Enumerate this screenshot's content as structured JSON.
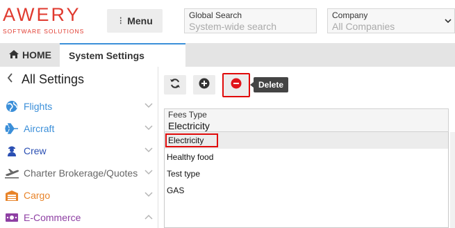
{
  "brand": {
    "name": "AWERY",
    "tagline": "SOFTWARE SOLUTIONS",
    "color": "#e03a2f"
  },
  "header": {
    "menu_label": "Menu",
    "search": {
      "label": "Global Search",
      "placeholder": "System-wide search"
    },
    "company": {
      "label": "Company",
      "value": "All Companies"
    }
  },
  "tabs": [
    {
      "label": "HOME",
      "icon": "home-icon"
    },
    {
      "label": "System Settings",
      "active": true
    }
  ],
  "sidebar": {
    "title": "All Settings",
    "items": [
      {
        "label": "Flights",
        "icon": "globe-icon",
        "color": "#3b8fd9"
      },
      {
        "label": "Aircraft",
        "icon": "plane-icon",
        "color": "#3b8fd9"
      },
      {
        "label": "Crew",
        "icon": "crew-icon",
        "color": "#2a4fb3"
      },
      {
        "label": "Charter Brokerage/Quotes",
        "icon": "plane-takeoff-icon",
        "color": "#666666"
      },
      {
        "label": "Cargo",
        "icon": "warehouse-icon",
        "color": "#e8842a"
      },
      {
        "label": "E-Commerce",
        "icon": "money-icon",
        "color": "#8e3fa3",
        "expanded": true
      }
    ]
  },
  "toolbar": {
    "refresh_icon": "refresh-icon",
    "add_icon": "plus-circle-icon",
    "delete_icon": "minus-circle-icon",
    "delete_tooltip": "Delete"
  },
  "fees_type": {
    "label": "Fees Type",
    "value": "Electricity",
    "options": [
      "Electricity",
      "Healthy food",
      "Test type",
      "GAS"
    ]
  }
}
